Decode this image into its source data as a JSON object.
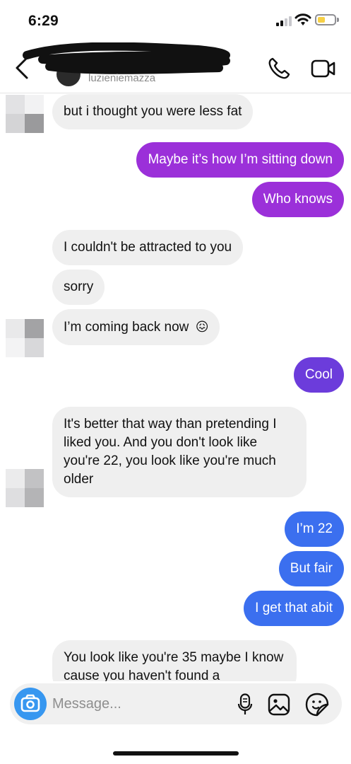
{
  "status_bar": {
    "time": "6:29",
    "battery_color": "#f7d046"
  },
  "header": {
    "username": "luzieniemazza",
    "back_icon": "chevron-left-icon",
    "call_icon": "phone-icon",
    "video_icon": "video-camera-icon"
  },
  "colors": {
    "purple": "#9b30d9",
    "violet": "#6c3cdb",
    "blue": "#3b6fef",
    "incoming_bg": "#efefef"
  },
  "messages": [
    {
      "side": "in",
      "text": "but i thought you were less fat"
    },
    {
      "side": "out",
      "text": "Maybe it’s how I’m sitting down"
    },
    {
      "side": "out",
      "text": "Who knows"
    },
    {
      "side": "in",
      "text": "I couldn't be attracted to you"
    },
    {
      "side": "in",
      "text": "sorry"
    },
    {
      "side": "in",
      "text": "I’m coming back now",
      "emoji": "😖"
    },
    {
      "side": "out",
      "text": "Cool"
    },
    {
      "side": "in",
      "text": "It's better that way than pretending I liked you.  And you don't look like you're 22, you look like you're much older"
    },
    {
      "side": "out",
      "text": "I’m 22"
    },
    {
      "side": "out",
      "text": "But fair"
    },
    {
      "side": "out",
      "text": "I get that abit"
    },
    {
      "side": "in",
      "text": "You look like you're 35 maybe I know cause you haven't found a"
    }
  ],
  "composer": {
    "placeholder": "Message...",
    "camera_icon": "camera-icon",
    "mic_icon": "microphone-icon",
    "gallery_icon": "image-icon",
    "sticker_icon": "sticker-icon"
  }
}
